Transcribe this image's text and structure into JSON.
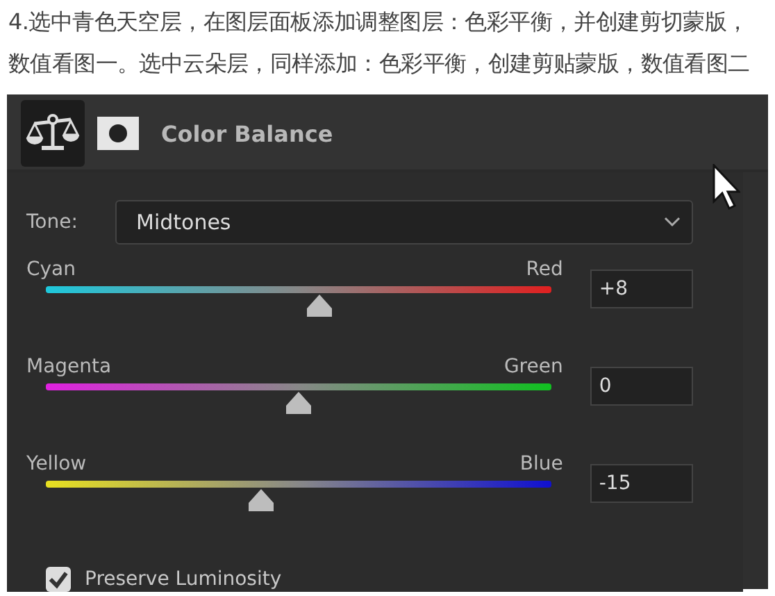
{
  "caption": "4.选中青色天空层，在图层面板添加调整图层：色彩平衡，并创建剪切蒙版，数值看图一。选中云朵层，同样添加：色彩平衡，创建剪贴蒙版，数值看图二",
  "panel": {
    "title": "Color Balance",
    "tone": {
      "label": "Tone:",
      "value": "Midtones"
    },
    "channels": [
      {
        "left": "Cyan",
        "right": "Red",
        "level": 0.54,
        "value": "+8"
      },
      {
        "left": "Magenta",
        "right": "Green",
        "level": 0.5,
        "value": "0"
      },
      {
        "left": "Yellow",
        "right": "Blue",
        "level": 0.425,
        "value": "-15"
      }
    ],
    "preserve_luminosity": {
      "label": "Preserve Luminosity",
      "checked": true
    }
  }
}
